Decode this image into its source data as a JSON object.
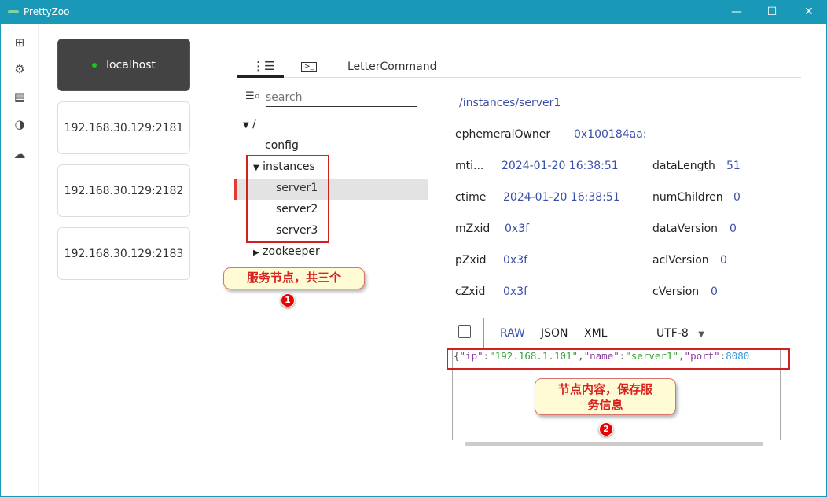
{
  "window": {
    "title": "PrettyZoo",
    "controls": [
      "—",
      "☐",
      "✕"
    ]
  },
  "sidebar": {
    "icons": [
      "add-icon",
      "gear-icon",
      "calendar-icon",
      "theme-icon",
      "cloud-upload-icon"
    ]
  },
  "servers": [
    {
      "label": "localhost",
      "connected": true
    },
    {
      "label": "192.168.30.129:2181"
    },
    {
      "label": "192.168.30.129:2182"
    },
    {
      "label": "192.168.30.129:2183"
    }
  ],
  "tabs": {
    "tree_icon": "tree-icon",
    "terminal_icon": "terminal-icon",
    "command_label": "LetterCommand"
  },
  "search": {
    "placeholder": "search"
  },
  "tree": {
    "root": "/",
    "config": "config",
    "instances": "instances",
    "children": [
      "server1",
      "server2",
      "server3"
    ],
    "zookeeper": "zookeeper",
    "selected": "server1"
  },
  "node": {
    "path": "/instances/server1",
    "ephemeralOwner": {
      "label": "ephemeralOwner",
      "value": "0x100184aa:"
    },
    "mtime": {
      "label": "mti...",
      "value": "2024-01-20 16:38:51"
    },
    "ctime": {
      "label": "ctime",
      "value": "2024-01-20 16:38:51"
    },
    "mZxid": {
      "label": "mZxid",
      "value": "0x3f"
    },
    "pZxid": {
      "label": "pZxid",
      "value": "0x3f"
    },
    "cZxid": {
      "label": "cZxid",
      "value": "0x3f"
    },
    "dataLength": {
      "label": "dataLength",
      "value": "51"
    },
    "numChildren": {
      "label": "numChildren",
      "value": "0"
    },
    "dataVersion": {
      "label": "dataVersion",
      "value": "0"
    },
    "aclVersion": {
      "label": "aclVersion",
      "value": "0"
    },
    "cVersion": {
      "label": "cVersion",
      "value": "0"
    }
  },
  "editor": {
    "formats": [
      "RAW",
      "JSON",
      "XML"
    ],
    "selected_format": "RAW",
    "encoding": "UTF-8",
    "content": [
      {
        "t": "{",
        "c": "#555"
      },
      {
        "t": "\"ip\"",
        "c": "#8a3c9e"
      },
      {
        "t": ":",
        "c": "#555"
      },
      {
        "t": "\"192.168.1.101\"",
        "c": "#3aa63a"
      },
      {
        "t": ",",
        "c": "#555"
      },
      {
        "t": "\"name\"",
        "c": "#8a3c9e"
      },
      {
        "t": ":",
        "c": "#555"
      },
      {
        "t": "\"server1\"",
        "c": "#3aa63a"
      },
      {
        "t": ",",
        "c": "#555"
      },
      {
        "t": "\"port\"",
        "c": "#8a3c9e"
      },
      {
        "t": ":",
        "c": "#555"
      },
      {
        "t": "8080",
        "c": "#3a9ad9"
      }
    ]
  },
  "annotations": {
    "a1": {
      "text": "服务节点，共三个",
      "num": "1"
    },
    "a2": {
      "line1": "节点内容，保存服",
      "line2": "务信息",
      "num": "2"
    }
  },
  "colors": {
    "titlebar": "#1a98b8",
    "accent": "#3a50a8",
    "selection_marker": "#e53935",
    "connected": "#1ec51e"
  }
}
